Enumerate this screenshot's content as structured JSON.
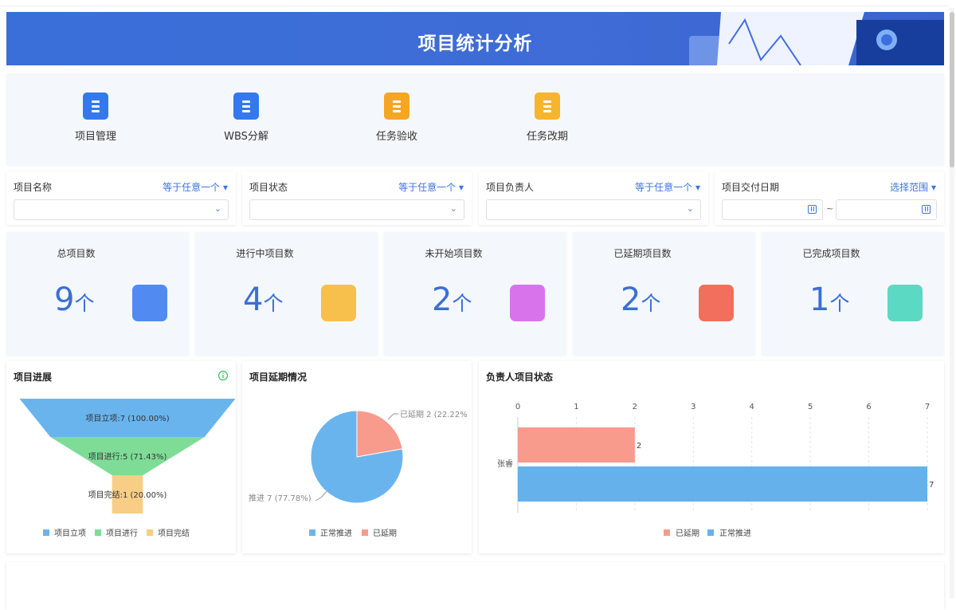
{
  "banner": {
    "title": "项目统计分析"
  },
  "quick_links": [
    {
      "label": "项目管理",
      "icon": "project-doc-icon",
      "color": "#3478f0"
    },
    {
      "label": "WBS分解",
      "icon": "wbs-icon",
      "color": "#3478f0"
    },
    {
      "label": "任务验收",
      "icon": "task-accept-icon",
      "color": "#f5a623"
    },
    {
      "label": "任务改期",
      "icon": "task-reschedule-icon",
      "color": "#f7b52c"
    }
  ],
  "filters": [
    {
      "label": "项目名称",
      "operator": "等于任意一个 ▾",
      "value": ""
    },
    {
      "label": "项目状态",
      "operator": "等于任意一个 ▾",
      "value": ""
    },
    {
      "label": "项目负责人",
      "operator": "等于任意一个 ▾",
      "value": ""
    },
    {
      "label": "项目交付日期",
      "operator": "选择范围 ▾",
      "start": "",
      "end": "",
      "sep": "~"
    }
  ],
  "stats": [
    {
      "title": "总项目数",
      "value": "9",
      "unit": "个",
      "icon": "document-icon",
      "color": "#3478f0"
    },
    {
      "title": "进行中项目数",
      "value": "4",
      "unit": "个",
      "icon": "folder-icon",
      "color": "#f7b52c"
    },
    {
      "title": "未开始项目数",
      "value": "2",
      "unit": "个",
      "icon": "grid-icon",
      "color": "#d35ce8"
    },
    {
      "title": "已延期项目数",
      "value": "2",
      "unit": "个",
      "icon": "flag-icon",
      "color": "#f0573f"
    },
    {
      "title": "已完成项目数",
      "value": "1",
      "unit": "个",
      "icon": "chart-badge-icon",
      "color": "#3fd3b8"
    }
  ],
  "chart_data": [
    {
      "type": "funnel",
      "title": "项目进展",
      "categories": [
        "项目立项",
        "项目进行",
        "项目完结"
      ],
      "values": [
        7,
        5,
        1
      ],
      "percents": [
        "100.00%",
        "71.43%",
        "20.00%"
      ],
      "labels": [
        "项目立项:7 (100.00%)",
        "项目进行:5 (71.43%)",
        "项目完结:1 (20.00%)"
      ],
      "colors": [
        "#6ab4ee",
        "#7edc97",
        "#f8cd85"
      ],
      "legend": "bottom"
    },
    {
      "type": "pie",
      "title": "项目延期情况",
      "categories": [
        "正常推进",
        "已延期"
      ],
      "values": [
        7,
        2
      ],
      "labels": [
        "推进 7 (77.78%)",
        "已延期 2 (22.22%"
      ],
      "colors": [
        "#6ab4ee",
        "#f89a8c"
      ],
      "legend": "bottom"
    },
    {
      "type": "bar",
      "orientation": "horizontal",
      "title": "负责人项目状态",
      "categories": [
        "张睿"
      ],
      "series": [
        {
          "name": "已延期",
          "values": [
            2
          ],
          "color": "#f89a8c"
        },
        {
          "name": "正常推进",
          "values": [
            7
          ],
          "color": "#64b1ec"
        }
      ],
      "xlim": [
        0,
        7
      ],
      "xticks": [
        "0",
        "1",
        "2",
        "3",
        "4",
        "5",
        "6",
        "7"
      ],
      "grid": true,
      "legend": "bottom"
    }
  ]
}
